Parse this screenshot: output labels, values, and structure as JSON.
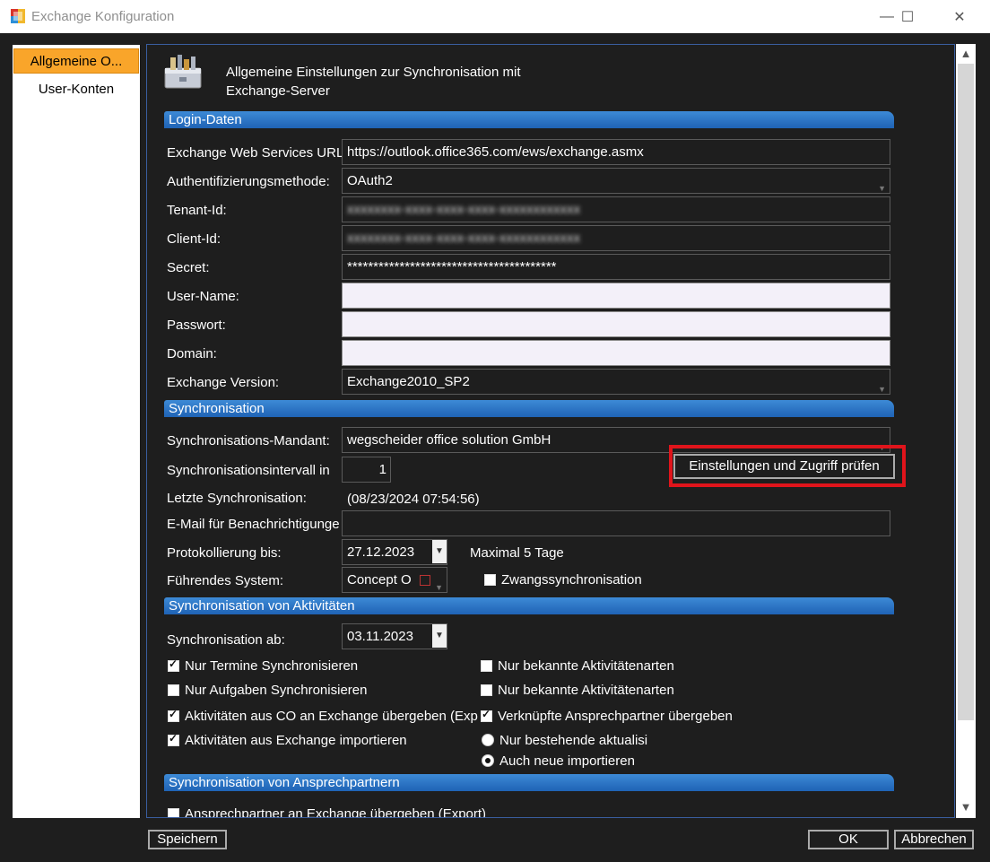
{
  "window": {
    "title": "Exchange Konfiguration",
    "minimize": "—",
    "maximize": "☐",
    "close": "✕"
  },
  "nav": {
    "items": [
      {
        "label": "Allgemeine O..."
      },
      {
        "label": "User-Konten"
      }
    ]
  },
  "header": {
    "title_line1": "Allgemeine Einstellungen zur Synchronisation mit",
    "title_line2": "Exchange-Server"
  },
  "sections": {
    "login": "Login-Daten",
    "sync": "Synchronisation",
    "activities": "Synchronisation von Aktivitäten",
    "contacts": "Synchronisation von Ansprechpartnern"
  },
  "login": {
    "ews_label": "Exchange Web Services URL",
    "ews_value": "https://outlook.office365.com/ews/exchange.asmx",
    "auth_label": "Authentifizierungsmethode:",
    "auth_value": "OAuth2",
    "tenant_label": "Tenant-Id:",
    "tenant_value": "xxxxxxxx-xxxx-xxxx-xxxx-xxxxxxxxxxxx",
    "client_label": "Client-Id:",
    "client_value": "xxxxxxxx-xxxx-xxxx-xxxx-xxxxxxxxxxxx",
    "secret_label": "Secret:",
    "secret_value": "****************************************",
    "user_label": "User-Name:",
    "user_value": "",
    "password_label": "Passwort:",
    "password_value": "",
    "domain_label": "Domain:",
    "domain_value": "",
    "version_label": "Exchange Version:",
    "version_value": "Exchange2010_SP2"
  },
  "sync": {
    "mandant_label": "Synchronisations-Mandant:",
    "mandant_value": "wegscheider office solution GmbH",
    "check_button": "Einstellungen und Zugriff prüfen",
    "interval_label": "Synchronisationsintervall in",
    "interval_value": "1",
    "last_label": "Letzte Synchronisation:",
    "last_value": "(08/23/2024 07:54:56)",
    "email_label": "E-Mail für Benachrichtigunge",
    "email_value": "",
    "log_label": "Protokollierung bis:",
    "log_value": "27.12.2023",
    "log_hint": "Maximal 5 Tage",
    "leading_label": "Führendes System:",
    "leading_value": "Concept O",
    "force_label": "Zwangssynchronisation"
  },
  "activities": {
    "from_label": "Synchronisation ab:",
    "from_value": "03.11.2023",
    "opt_termine": "Nur Termine Synchronisieren",
    "opt_aufgaben": "Nur Aufgaben Synchronisieren",
    "opt_export": "Aktivitäten aus CO an Exchange übergeben (Exp",
    "opt_import": "Aktivitäten aus Exchange importieren",
    "opt_known1": "Nur bekannte Aktivitätenarten",
    "opt_known2": "Nur bekannte Aktivitätenarten",
    "opt_linked": "Verknüpfte Ansprechpartner übergeben",
    "radio_existing": "Nur bestehende aktualisi",
    "radio_new": "Auch neue importieren"
  },
  "contacts": {
    "opt_export": "Ansprechpartner an Exchange übergeben (Export)"
  },
  "footer": {
    "save": "Speichern",
    "ok": "OK",
    "cancel": "Abbrechen"
  },
  "colors": {
    "accent_nav": "#f9a52a",
    "section_bar": "#2a73c6",
    "highlight": "#e0141b"
  }
}
